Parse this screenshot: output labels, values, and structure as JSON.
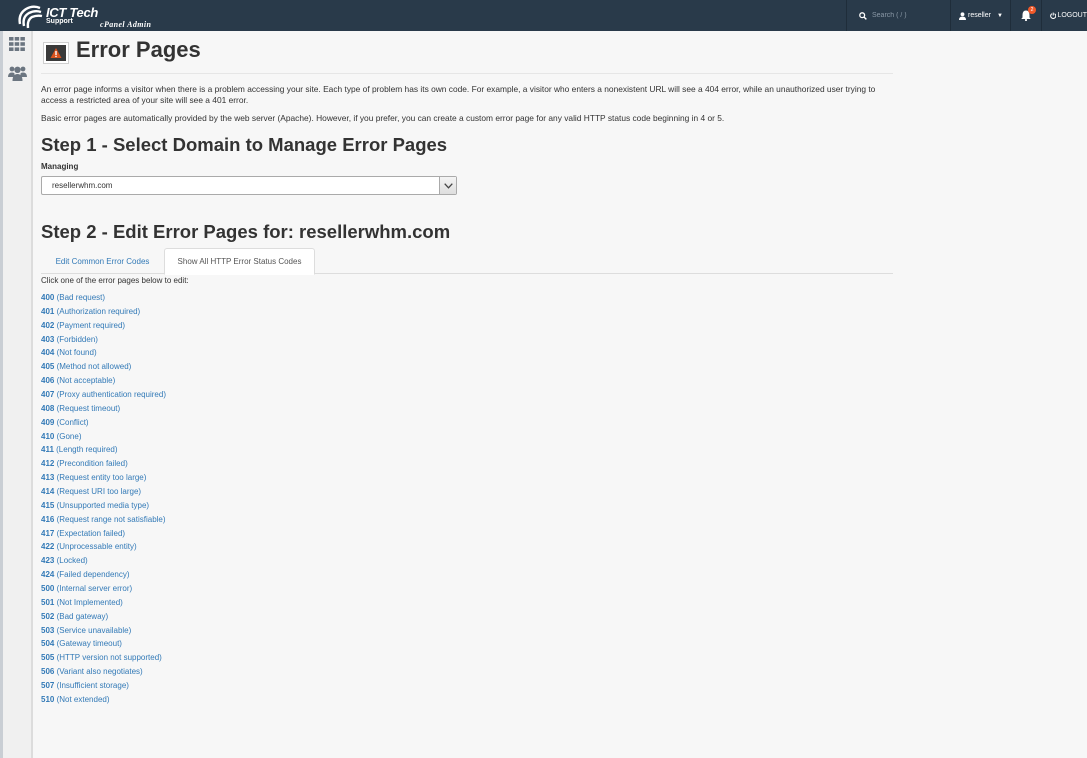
{
  "topbar": {
    "logo_title": "ICT Tech",
    "logo_support": "Support",
    "logo_subtitle": "cPanel Admin",
    "search_placeholder": "Search ( / )",
    "user": "reseller",
    "notification_count": "2",
    "logout": "LOGOUT"
  },
  "page": {
    "title": "Error Pages",
    "desc1": "An error page informs a visitor when there is a problem accessing your site. Each type of problem has its own code. For example, a visitor who enters a nonexistent URL will see a 404 error, while an unauthorized user trying to access a restricted area of your site will see a 401 error.",
    "desc2": "Basic error pages are automatically provided by the web server (Apache). However, if you prefer, you can create a custom error page for any valid HTTP status code beginning in 4 or 5.",
    "step1": "Step 1 - Select Domain to Manage Error Pages",
    "managing_label": "Managing",
    "selected_domain": "resellerwhm.com",
    "step2": "Step 2 - Edit Error Pages for: resellerwhm.com",
    "tabs": [
      "Edit Common Error Codes",
      "Show All HTTP Error Status Codes"
    ],
    "click_hint": "Click one of the error pages below to edit:"
  },
  "error_codes": [
    {
      "code": "400",
      "label": "(Bad request)"
    },
    {
      "code": "401",
      "label": "(Authorization required)"
    },
    {
      "code": "402",
      "label": "(Payment required)"
    },
    {
      "code": "403",
      "label": "(Forbidden)"
    },
    {
      "code": "404",
      "label": "(Not found)"
    },
    {
      "code": "405",
      "label": "(Method not allowed)"
    },
    {
      "code": "406",
      "label": "(Not acceptable)"
    },
    {
      "code": "407",
      "label": "(Proxy authentication required)"
    },
    {
      "code": "408",
      "label": "(Request timeout)"
    },
    {
      "code": "409",
      "label": "(Conflict)"
    },
    {
      "code": "410",
      "label": "(Gone)"
    },
    {
      "code": "411",
      "label": "(Length required)"
    },
    {
      "code": "412",
      "label": "(Precondition failed)"
    },
    {
      "code": "413",
      "label": "(Request entity too large)"
    },
    {
      "code": "414",
      "label": "(Request URI too large)"
    },
    {
      "code": "415",
      "label": "(Unsupported media type)"
    },
    {
      "code": "416",
      "label": "(Request range not satisfiable)"
    },
    {
      "code": "417",
      "label": "(Expectation failed)"
    },
    {
      "code": "422",
      "label": "(Unprocessable entity)"
    },
    {
      "code": "423",
      "label": "(Locked)"
    },
    {
      "code": "424",
      "label": "(Failed dependency)"
    },
    {
      "code": "500",
      "label": "(Internal server error)"
    },
    {
      "code": "501",
      "label": "(Not Implemented)"
    },
    {
      "code": "502",
      "label": "(Bad gateway)"
    },
    {
      "code": "503",
      "label": "(Service unavailable)"
    },
    {
      "code": "504",
      "label": "(Gateway timeout)"
    },
    {
      "code": "505",
      "label": "(HTTP version not supported)"
    },
    {
      "code": "506",
      "label": "(Variant also negotiates)"
    },
    {
      "code": "507",
      "label": "(Insufficient storage)"
    },
    {
      "code": "510",
      "label": "(Not extended)"
    }
  ],
  "colors": {
    "topbar_bg": "#293a4a",
    "link": "#337ab7",
    "badge": "#f0592a",
    "warning_icon": "#d9531e"
  },
  "icons": {
    "logo": "ict-logo-icon",
    "search": "search-icon",
    "user": "user-icon",
    "bell": "bell-icon",
    "logout": "power-icon",
    "sidebar_1": "grid-icon",
    "sidebar_2": "users-icon",
    "header": "warning-icon",
    "select": "chevron-down-icon"
  }
}
